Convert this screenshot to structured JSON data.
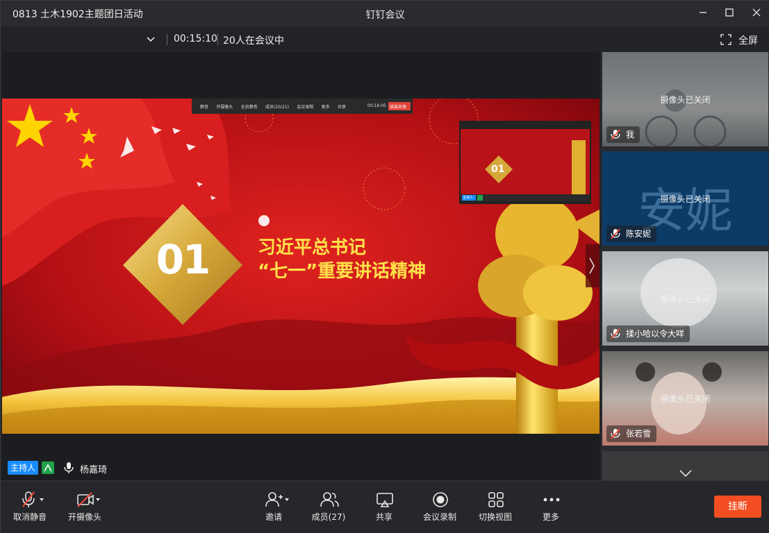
{
  "window": {
    "title": "钉钉会议"
  },
  "infobar": {
    "meeting_name": "0813 土木1902主题团日活动",
    "elapsed": "00:15:10",
    "participants_status": "20人在会议中",
    "fullscreen_label": "全屏"
  },
  "slide": {
    "number": "01",
    "line1": "习近平总书记",
    "line2": "“七一”重要讲话精神",
    "inner_toolbar": [
      "静音",
      "开摄像头",
      "全员静音",
      "成员(20/21)",
      "会议录制",
      "更多",
      "共享"
    ],
    "inner_timer": "00:16:05",
    "inner_stop": "结束共享",
    "inner_host": "主持人"
  },
  "stage": {
    "host_badge": "主持人",
    "speaker_name": "杨嘉琦"
  },
  "participants": [
    {
      "name": "我",
      "status": "摄像头已关闭"
    },
    {
      "name": "陈安妮",
      "status": "摄像头已关闭",
      "avatar_text": "安妮"
    },
    {
      "name": "揉小哈以令大咩",
      "status": "摄像头已关闭"
    },
    {
      "name": "张若雪",
      "status": "摄像头已关闭"
    }
  ],
  "toolbar": {
    "unmute": "取消静音",
    "camera": "开摄像头",
    "invite": "邀请",
    "members": "成员(27)",
    "share": "共享",
    "record": "会议录制",
    "switch_view": "切换视图",
    "more": "更多",
    "hangup": "挂断"
  },
  "colors": {
    "accent": "#1a8cff",
    "hangup": "#f24e22",
    "slide_red": "#c8141a",
    "gold": "#f0b93a"
  }
}
